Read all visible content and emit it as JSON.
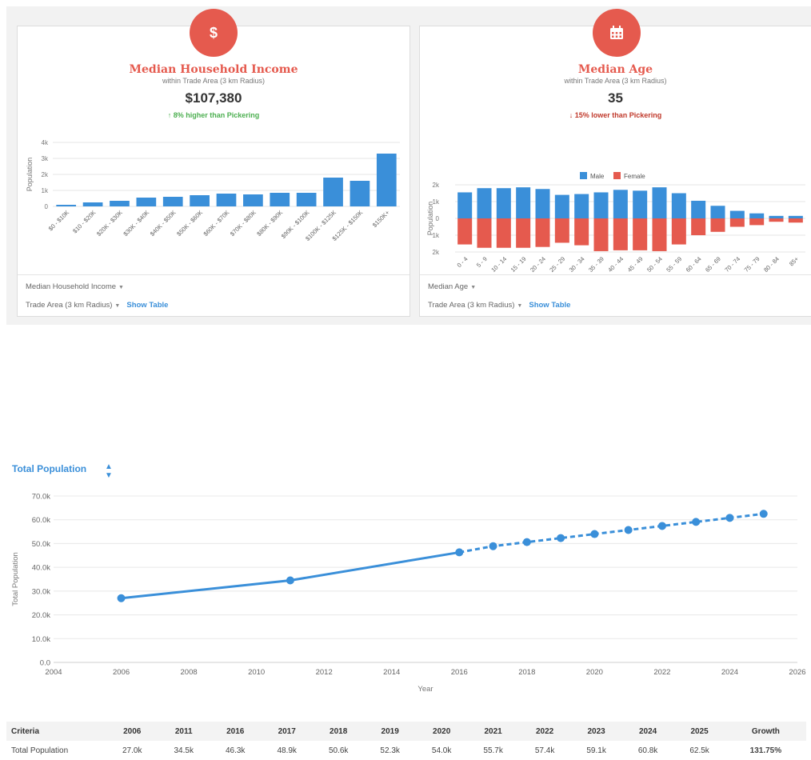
{
  "colors": {
    "accent": "#e55a4e",
    "male": "#3a8fd9",
    "female": "#e55a4e",
    "income_bar": "#3a8fd9",
    "line": "#3a8fd9",
    "growth": "#2e9d3a"
  },
  "income_card": {
    "icon": "dollar-icon",
    "title": "Median Household Income",
    "subtitle": "within Trade Area (3 km Radius)",
    "value": "$107,380",
    "compare": "↑ 8% higher than Pickering",
    "metric_dropdown": "Median Household Income",
    "area_dropdown": "Trade Area (3 km Radius)",
    "show_table": "Show Table"
  },
  "age_card": {
    "icon": "calendar-icon",
    "title": "Median Age",
    "subtitle": "within Trade Area (3 km Radius)",
    "value": "35",
    "compare": "↓ 15% lower than Pickering",
    "metric_dropdown": "Median Age",
    "area_dropdown": "Trade Area (3 km Radius)",
    "show_table": "Show Table"
  },
  "population_section": {
    "title": "Total Population",
    "sort_icon": "sort-arrows-icon"
  },
  "chart_data": [
    {
      "type": "bar",
      "ylabel": "Population",
      "categories": [
        "$0 - $10K",
        "$10 - $20K",
        "$20K - $30K",
        "$30K - $40K",
        "$40K - $50K",
        "$50K - $60K",
        "$60K - $70K",
        "$70K - $80K",
        "$80K - $90K",
        "$90K - $100K",
        "$100K - $125K",
        "$125K - $150K",
        "$150K+"
      ],
      "values": [
        100,
        250,
        350,
        550,
        600,
        700,
        800,
        750,
        850,
        850,
        1800,
        1600,
        3300
      ],
      "ylim": [
        0,
        4000
      ],
      "yticks": [
        0,
        1000,
        2000,
        3000,
        4000
      ],
      "ytick_labels": [
        "0",
        "1k",
        "2k",
        "3k",
        "4k"
      ]
    },
    {
      "type": "bar",
      "ylabel": "Population",
      "categories": [
        "0 - 4",
        "5 - 9",
        "10 - 14",
        "15 - 19",
        "20 - 24",
        "25 - 29",
        "30 - 34",
        "35 - 39",
        "40 - 44",
        "45 - 49",
        "50 - 54",
        "55 - 59",
        "60 - 64",
        "65 - 69",
        "70 - 74",
        "75 - 79",
        "80 - 84",
        "85+"
      ],
      "series": [
        {
          "name": "Male",
          "values": [
            1550,
            1800,
            1800,
            1850,
            1750,
            1400,
            1450,
            1550,
            1700,
            1650,
            1850,
            1500,
            1050,
            750,
            450,
            300,
            150,
            150
          ]
        },
        {
          "name": "Female",
          "values": [
            1550,
            1750,
            1750,
            1750,
            1700,
            1450,
            1600,
            1950,
            1900,
            1900,
            1950,
            1550,
            1000,
            800,
            500,
            400,
            200,
            250
          ]
        }
      ],
      "ylim": [
        -2000,
        2000
      ],
      "yticks": [
        2000,
        1000,
        0,
        -1000,
        -2000
      ],
      "ytick_labels": [
        "2k",
        "1k",
        "0",
        "1k",
        "2k"
      ],
      "legend": "top-center"
    },
    {
      "type": "line",
      "xlabel": "Year",
      "ylabel": "Total Population",
      "x": [
        2006,
        2011,
        2016,
        2017,
        2018,
        2019,
        2020,
        2021,
        2022,
        2023,
        2024,
        2025
      ],
      "values": [
        27000,
        34500,
        46300,
        48900,
        50600,
        52300,
        54000,
        55700,
        57400,
        59100,
        60800,
        62500
      ],
      "projected_from": 2016,
      "xlim": [
        2004,
        2026
      ],
      "ylim": [
        0,
        70000
      ],
      "xticks": [
        2004,
        2006,
        2008,
        2010,
        2012,
        2014,
        2016,
        2018,
        2020,
        2022,
        2024,
        2026
      ],
      "yticks": [
        0,
        10000,
        20000,
        30000,
        40000,
        50000,
        60000,
        70000
      ],
      "ytick_labels": [
        "0.0",
        "10.0k",
        "20.0k",
        "30.0k",
        "40.0k",
        "50.0k",
        "60.0k",
        "70.0k"
      ],
      "grid": true
    }
  ],
  "table": {
    "headers": [
      "Criteria",
      "2006",
      "2011",
      "2016",
      "2017",
      "2018",
      "2019",
      "2020",
      "2021",
      "2022",
      "2023",
      "2024",
      "2025",
      "Growth"
    ],
    "row": [
      "Total Population",
      "27.0k",
      "34.5k",
      "46.3k",
      "48.9k",
      "50.6k",
      "52.3k",
      "54.0k",
      "55.7k",
      "57.4k",
      "59.1k",
      "60.8k",
      "62.5k",
      "131.75%"
    ]
  }
}
